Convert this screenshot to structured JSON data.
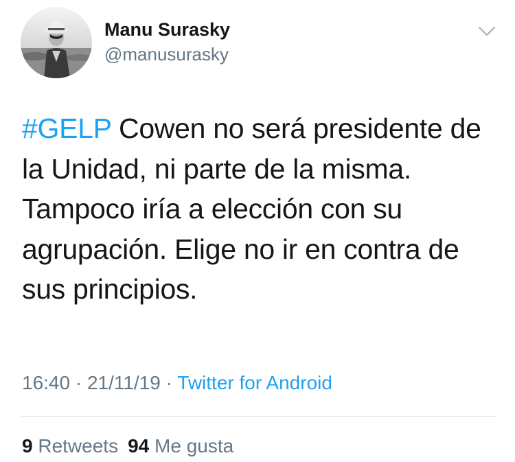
{
  "user": {
    "display_name": "Manu Surasky",
    "handle": "@manusurasky"
  },
  "tweet": {
    "hashtag": "#GELP",
    "text_lines": [
      " Cowen no será presidente de",
      "la Unidad, ni parte de la misma.",
      "Tampoco iría a elección con su",
      "agrupación. Elige no ir en contra de",
      "sus principios."
    ]
  },
  "meta": {
    "time": "16:40",
    "separator": " · ",
    "date": "21/11/19",
    "source": "Twitter for Android"
  },
  "stats": {
    "retweets_count": "9",
    "retweets_label": "Retweets",
    "likes_count": "94",
    "likes_label": "Me gusta"
  },
  "colors": {
    "link": "#1da1f2",
    "secondary_text": "#657786",
    "primary_text": "#14171a",
    "divider": "#e1e8ed"
  },
  "icons": {
    "menu": "chevron-down-icon"
  }
}
